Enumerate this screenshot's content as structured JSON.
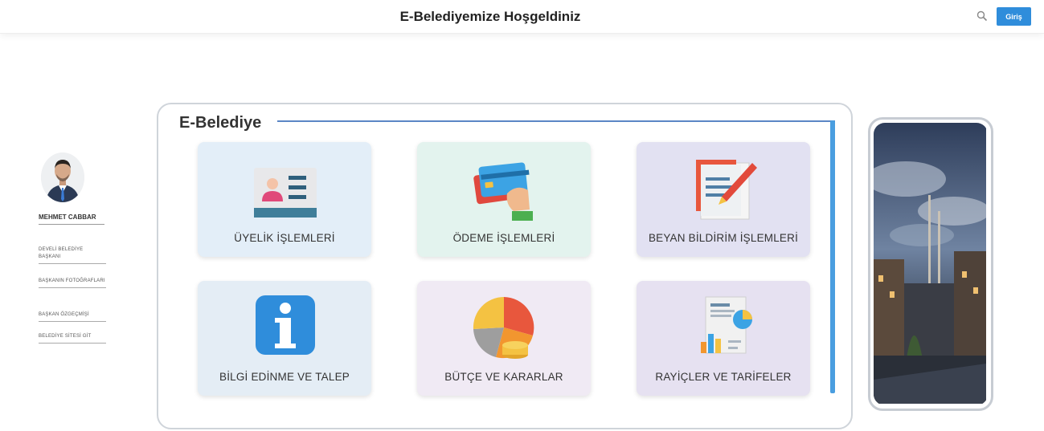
{
  "header": {
    "title": "E-Belediyemize Hoşgeldiniz",
    "login_label": "Giriş"
  },
  "sidebar": {
    "name": "MEHMET CABBAR",
    "links": [
      "DEVELİ BELEDİYE BAŞKANI",
      "BAŞKANIN FOTOĞRAFLARI",
      "BAŞKAN ÖZGEÇMİŞİ",
      "BELEDİYE SİTESİ GİT"
    ]
  },
  "panel": {
    "title": "E-Belediye",
    "cards": [
      {
        "label": "ÜYELİK İŞLEMLERİ",
        "icon": "id-card-icon",
        "color": "#e3eef8"
      },
      {
        "label": "ÖDEME İŞLEMLERİ",
        "icon": "payment-card-icon",
        "color": "#e3f3ee"
      },
      {
        "label": "BEYAN BİLDİRİM İŞLEMLERİ",
        "icon": "declaration-form-icon",
        "color": "#e2e1f2"
      },
      {
        "label": "BİLGİ EDİNME VE TALEP",
        "icon": "info-icon",
        "color": "#e4edf5"
      },
      {
        "label": "BÜTÇE VE KARARLAR",
        "icon": "budget-pie-icon",
        "color": "#f0eaf4"
      },
      {
        "label": "RAYİÇLER VE TARİFELER",
        "icon": "tariff-report-icon",
        "color": "#e6e1f1"
      }
    ]
  },
  "colors": {
    "accent": "#2f8ddb",
    "panel_line": "#5b86c5"
  }
}
